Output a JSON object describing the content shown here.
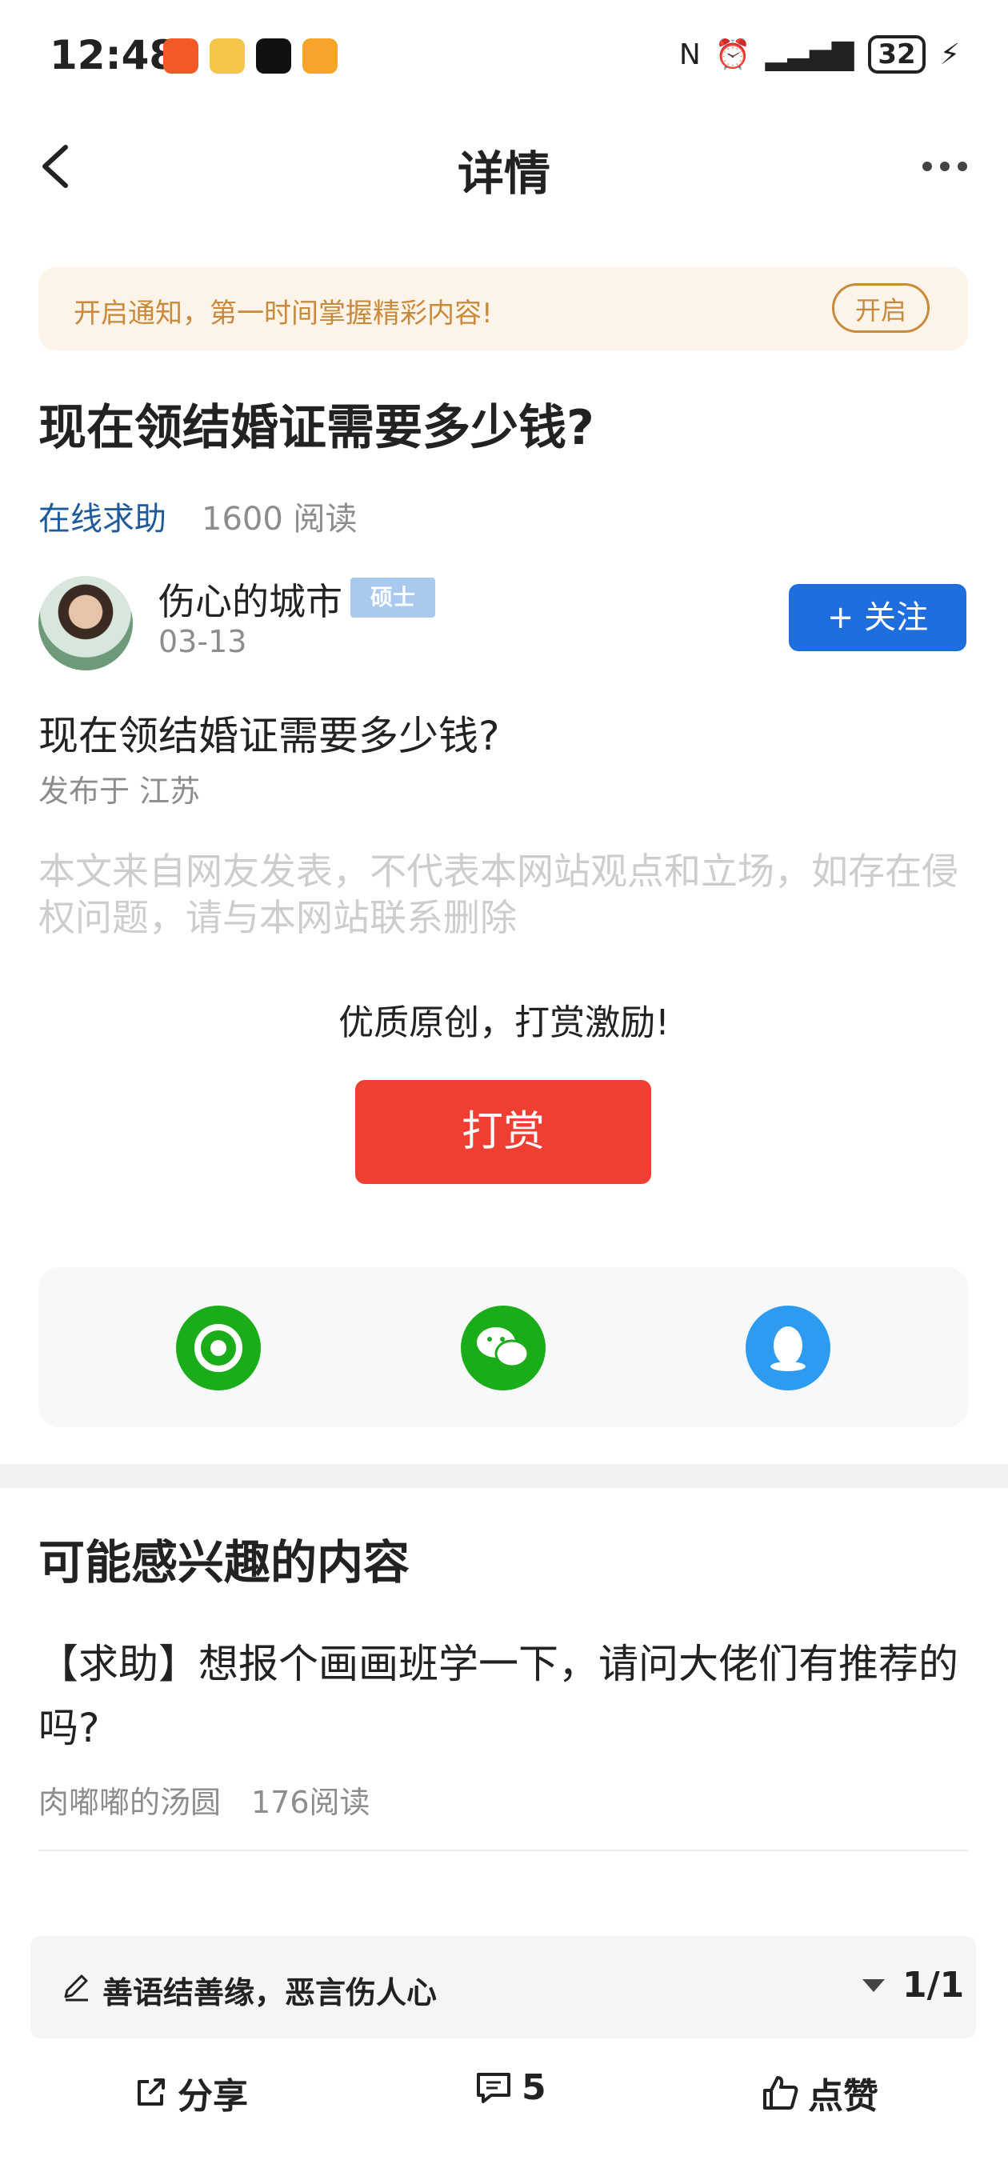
{
  "status_bar": {
    "time": "12:48",
    "battery": "32"
  },
  "header": {
    "title": "详情"
  },
  "banner": {
    "text": "开启通知，第一时间掌握精彩内容!",
    "button": "开启"
  },
  "article": {
    "title": "现在领结婚证需要多少钱?",
    "category": "在线求助",
    "reads": "1600 阅读",
    "author": {
      "name": "伤心的城市",
      "badge": "硕士",
      "date": "03-13"
    },
    "follow_label": "+ 关注",
    "body": "现在领结婚证需要多少钱?",
    "location": "发布于 江苏",
    "disclaimer": "本文来自网友发表，不代表本网站观点和立场，如存在侵权问题，请与本网站联系删除"
  },
  "reward": {
    "prompt": "优质原创，打赏激励!",
    "button": "打赏"
  },
  "share": {
    "icons": [
      "moments-icon",
      "wechat-icon",
      "qq-icon"
    ]
  },
  "related": {
    "title": "可能感兴趣的内容",
    "items": [
      {
        "title": "【求助】想报个画画班学一下，请问大佬们有推荐的吗?",
        "author": "肉嘟嘟的汤圆",
        "reads": "176阅读"
      }
    ]
  },
  "comment_bar": {
    "placeholder": "善语结善缘，恶言伤人心",
    "page": "1/1"
  },
  "actions": {
    "share": "分享",
    "comments": "5",
    "like": "点赞"
  },
  "colors": {
    "accent_blue": "#1e6ee0",
    "reward_red": "#ef3e32",
    "banner_orange": "#c98a3c",
    "wechat_green": "#1aad19",
    "qq_blue": "#2d9cf0"
  }
}
